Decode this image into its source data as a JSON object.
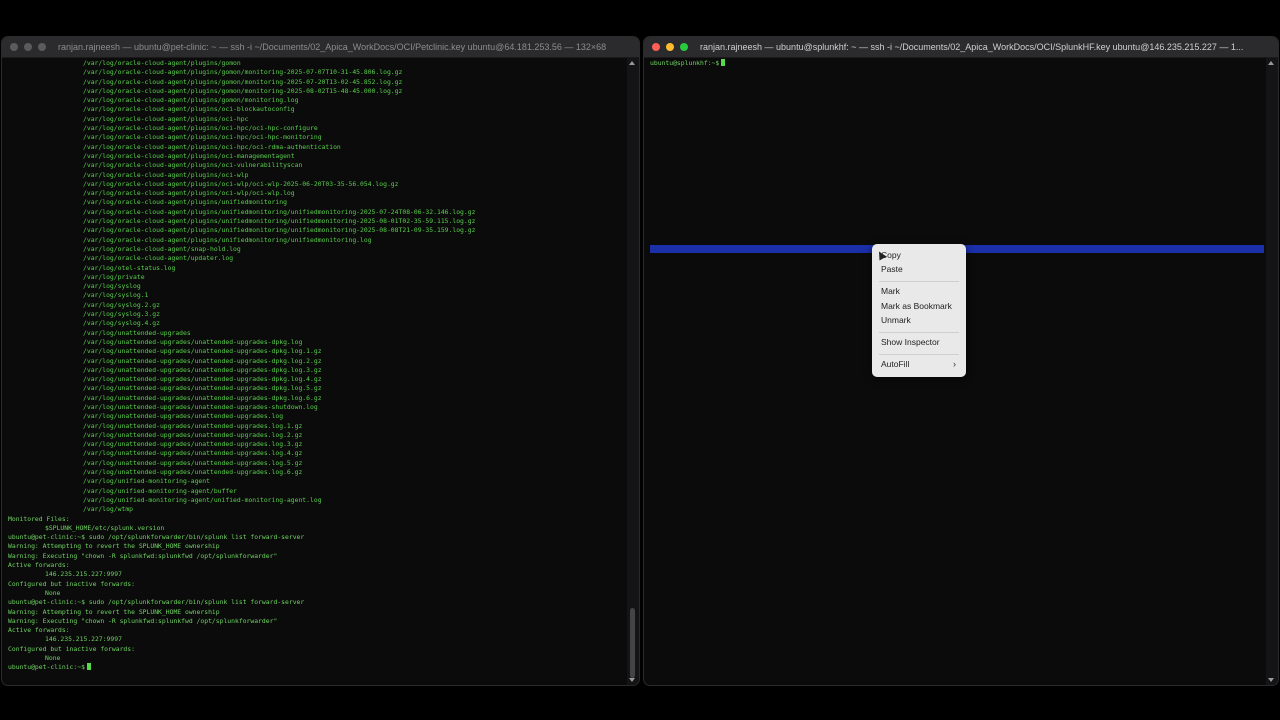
{
  "left_window": {
    "title": "ranjan.rajneesh — ubuntu@pet-clinic: ~ — ssh -i ~/Documents/02_Apica_WorkDocs/OCI/Petclinic.key ubuntu@64.181.253.56 — 132×68",
    "lines": [
      {
        "text": "/var/log/oracle-cloud-agent/plugins/gomon",
        "type": "path"
      },
      {
        "text": "/var/log/oracle-cloud-agent/plugins/gomon/monitoring-2025-07-07T10-31-45.806.log.gz",
        "type": "path"
      },
      {
        "text": "/var/log/oracle-cloud-agent/plugins/gomon/monitoring-2025-07-20T13-02-45.852.log.gz",
        "type": "path"
      },
      {
        "text": "/var/log/oracle-cloud-agent/plugins/gomon/monitoring-2025-08-02T15-48-45.000.log.gz",
        "type": "path"
      },
      {
        "text": "/var/log/oracle-cloud-agent/plugins/gomon/monitoring.log",
        "type": "path"
      },
      {
        "text": "/var/log/oracle-cloud-agent/plugins/oci-blockautoconfig",
        "type": "path"
      },
      {
        "text": "/var/log/oracle-cloud-agent/plugins/oci-hpc",
        "type": "path"
      },
      {
        "text": "/var/log/oracle-cloud-agent/plugins/oci-hpc/oci-hpc-configure",
        "type": "path"
      },
      {
        "text": "/var/log/oracle-cloud-agent/plugins/oci-hpc/oci-hpc-monitoring",
        "type": "path"
      },
      {
        "text": "/var/log/oracle-cloud-agent/plugins/oci-hpc/oci-rdma-authentication",
        "type": "path"
      },
      {
        "text": "/var/log/oracle-cloud-agent/plugins/oci-managementagent",
        "type": "path"
      },
      {
        "text": "/var/log/oracle-cloud-agent/plugins/oci-vulnerabilityscan",
        "type": "path"
      },
      {
        "text": "/var/log/oracle-cloud-agent/plugins/oci-wlp",
        "type": "path"
      },
      {
        "text": "/var/log/oracle-cloud-agent/plugins/oci-wlp/oci-wlp-2025-06-20T03-35-56.054.log.gz",
        "type": "path"
      },
      {
        "text": "/var/log/oracle-cloud-agent/plugins/oci-wlp/oci-wlp.log",
        "type": "path"
      },
      {
        "text": "/var/log/oracle-cloud-agent/plugins/unifiedmonitoring",
        "type": "path"
      },
      {
        "text": "/var/log/oracle-cloud-agent/plugins/unifiedmonitoring/unifiedmonitoring-2025-07-24T08-06-32.146.log.gz",
        "type": "path"
      },
      {
        "text": "/var/log/oracle-cloud-agent/plugins/unifiedmonitoring/unifiedmonitoring-2025-08-01T02-35-59.115.log.gz",
        "type": "path"
      },
      {
        "text": "/var/log/oracle-cloud-agent/plugins/unifiedmonitoring/unifiedmonitoring-2025-08-08T21-09-35.159.log.gz",
        "type": "path"
      },
      {
        "text": "/var/log/oracle-cloud-agent/plugins/unifiedmonitoring/unifiedmonitoring.log",
        "type": "path"
      },
      {
        "text": "/var/log/oracle-cloud-agent/snap-hold.log",
        "type": "path"
      },
      {
        "text": "/var/log/oracle-cloud-agent/updater.log",
        "type": "path"
      },
      {
        "text": "/var/log/otel-status.log",
        "type": "path"
      },
      {
        "text": "/var/log/private",
        "type": "path"
      },
      {
        "text": "/var/log/syslog",
        "type": "path"
      },
      {
        "text": "/var/log/syslog.1",
        "type": "path"
      },
      {
        "text": "/var/log/syslog.2.gz",
        "type": "path"
      },
      {
        "text": "/var/log/syslog.3.gz",
        "type": "path"
      },
      {
        "text": "/var/log/syslog.4.gz",
        "type": "path"
      },
      {
        "text": "/var/log/unattended-upgrades",
        "type": "path"
      },
      {
        "text": "/var/log/unattended-upgrades/unattended-upgrades-dpkg.log",
        "type": "path"
      },
      {
        "text": "/var/log/unattended-upgrades/unattended-upgrades-dpkg.log.1.gz",
        "type": "path"
      },
      {
        "text": "/var/log/unattended-upgrades/unattended-upgrades-dpkg.log.2.gz",
        "type": "path"
      },
      {
        "text": "/var/log/unattended-upgrades/unattended-upgrades-dpkg.log.3.gz",
        "type": "path"
      },
      {
        "text": "/var/log/unattended-upgrades/unattended-upgrades-dpkg.log.4.gz",
        "type": "path"
      },
      {
        "text": "/var/log/unattended-upgrades/unattended-upgrades-dpkg.log.5.gz",
        "type": "path"
      },
      {
        "text": "/var/log/unattended-upgrades/unattended-upgrades-dpkg.log.6.gz",
        "type": "path"
      },
      {
        "text": "/var/log/unattended-upgrades/unattended-upgrades-shutdown.log",
        "type": "path"
      },
      {
        "text": "/var/log/unattended-upgrades/unattended-upgrades.log",
        "type": "path"
      },
      {
        "text": "/var/log/unattended-upgrades/unattended-upgrades.log.1.gz",
        "type": "path"
      },
      {
        "text": "/var/log/unattended-upgrades/unattended-upgrades.log.2.gz",
        "type": "path"
      },
      {
        "text": "/var/log/unattended-upgrades/unattended-upgrades.log.3.gz",
        "type": "path"
      },
      {
        "text": "/var/log/unattended-upgrades/unattended-upgrades.log.4.gz",
        "type": "path"
      },
      {
        "text": "/var/log/unattended-upgrades/unattended-upgrades.log.5.gz",
        "type": "path"
      },
      {
        "text": "/var/log/unattended-upgrades/unattended-upgrades.log.6.gz",
        "type": "path"
      },
      {
        "text": "/var/log/unified-monitoring-agent",
        "type": "path"
      },
      {
        "text": "/var/log/unified-monitoring-agent/buffer",
        "type": "path"
      },
      {
        "text": "/var/log/unified-monitoring-agent/unified-monitoring-agent.log",
        "type": "path"
      },
      {
        "text": "/var/log/wtmp",
        "type": "path"
      },
      {
        "text": "Monitored Files:",
        "type": "plain"
      },
      {
        "text": "$SPLUNK_HOME/etc/splunk.version",
        "type": "indent"
      },
      {
        "text": "ubuntu@pet-clinic:~$ sudo /opt/splunkforwarder/bin/splunk list forward-server",
        "type": "plain"
      },
      {
        "text": "Warning: Attempting to revert the SPLUNK_HOME ownership",
        "type": "plain"
      },
      {
        "text": "Warning: Executing \"chown -R splunkfwd:splunkfwd /opt/splunkforwarder\"",
        "type": "plain"
      },
      {
        "text": "Active forwards:",
        "type": "plain"
      },
      {
        "text": "146.235.215.227:9997",
        "type": "indent"
      },
      {
        "text": "Configured but inactive forwards:",
        "type": "plain"
      },
      {
        "text": "None",
        "type": "indent"
      },
      {
        "text": "ubuntu@pet-clinic:~$ sudo /opt/splunkforwarder/bin/splunk list forward-server",
        "type": "plain"
      },
      {
        "text": "Warning: Attempting to revert the SPLUNK_HOME ownership",
        "type": "plain"
      },
      {
        "text": "Warning: Executing \"chown -R splunkfwd:splunkfwd /opt/splunkforwarder\"",
        "type": "plain"
      },
      {
        "text": "Active forwards:",
        "type": "plain"
      },
      {
        "text": "146.235.215.227:9997",
        "type": "indent"
      },
      {
        "text": "Configured but inactive forwards:",
        "type": "plain"
      },
      {
        "text": "None",
        "type": "indent"
      }
    ],
    "prompt": "ubuntu@pet-clinic:~$"
  },
  "right_window": {
    "title": "ranjan.rajneesh — ubuntu@splunkhf: ~ — ssh -i ~/Documents/02_Apica_WorkDocs/OCI/SplunkHF.key ubuntu@146.235.215.227 — 1...",
    "prompt": "ubuntu@splunkhf:~$"
  },
  "context_menu": {
    "copy": "Copy",
    "paste": "Paste",
    "mark": "Mark",
    "mark_as_bookmark": "Mark as Bookmark",
    "unmark": "Unmark",
    "show_inspector": "Show Inspector",
    "autofill": "AutoFill"
  },
  "colors": {
    "terminal_text": "#6fd461",
    "selection": "#1b2fa8",
    "menu_bg": "#e9e9ea"
  }
}
